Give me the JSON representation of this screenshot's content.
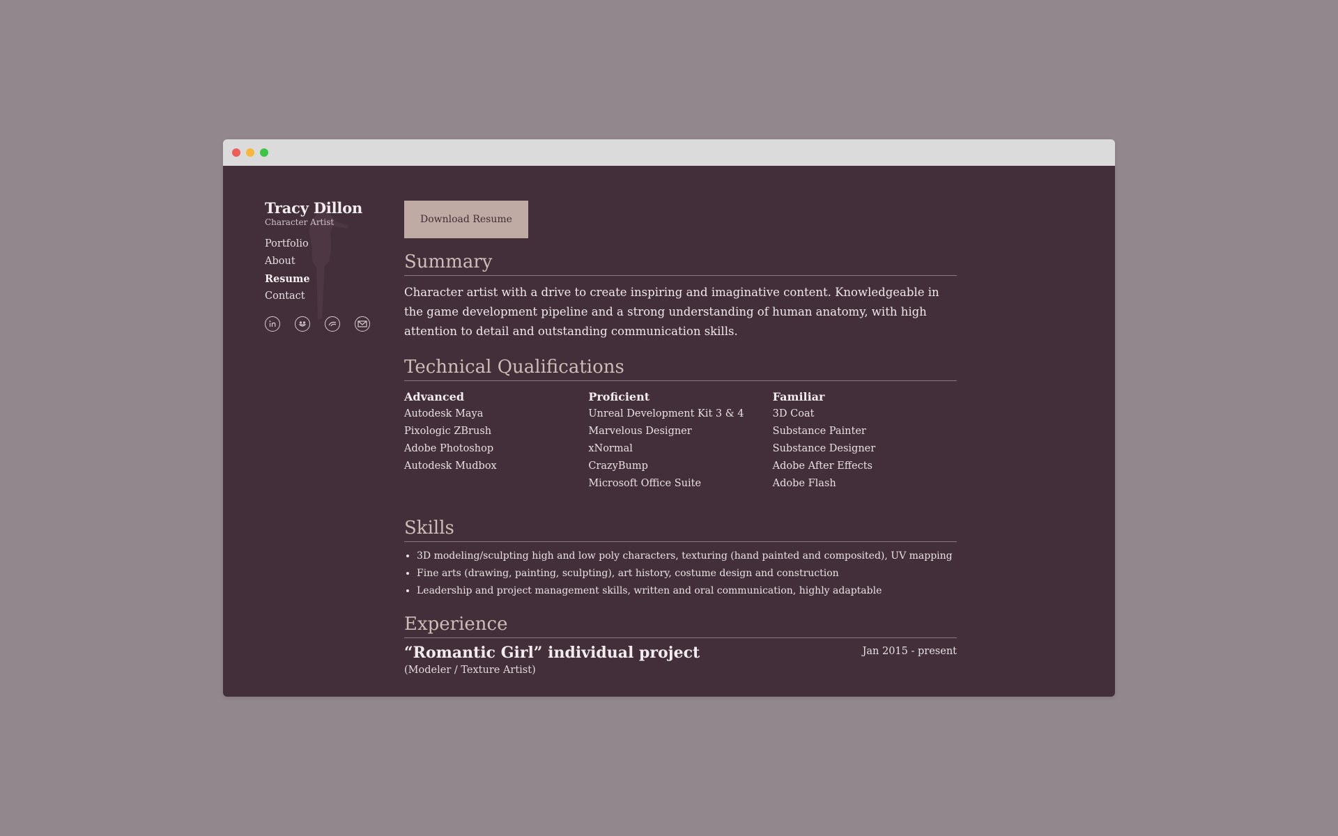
{
  "window": {
    "controls": [
      "close",
      "minimize",
      "maximize"
    ]
  },
  "sidebar": {
    "name": "Tracy Dillon",
    "subtitle": "Character Artist",
    "nav": [
      {
        "label": "Portfolio",
        "active": false
      },
      {
        "label": "About",
        "active": false
      },
      {
        "label": "Resume",
        "active": true
      },
      {
        "label": "Contact",
        "active": false
      }
    ],
    "social_icons": [
      "linkedin-icon",
      "smiley-icon",
      "artstation-icon",
      "mail-icon"
    ]
  },
  "main": {
    "download_button": "Download Resume",
    "summary": {
      "title": "Summary",
      "text": "Character artist with a drive to create inspiring and imaginative content. Knowledgeable in the game development pipeline and a strong understanding of human anatomy, with high attention to detail and outstanding communication skills."
    },
    "qualifications": {
      "title": "Technical Qualifications",
      "columns": [
        {
          "heading": "Advanced",
          "items": [
            "Autodesk Maya",
            "Pixologic ZBrush",
            "Adobe Photoshop",
            "Autodesk Mudbox"
          ]
        },
        {
          "heading": "Proficient",
          "items": [
            "Unreal Development Kit 3 & 4",
            "Marvelous Designer",
            "xNormal",
            "CrazyBump",
            "Microsoft Office Suite"
          ]
        },
        {
          "heading": "Familiar",
          "items": [
            "3D Coat",
            "Substance Painter",
            "Substance Designer",
            "Adobe After Effects",
            "Adobe Flash"
          ]
        }
      ]
    },
    "skills": {
      "title": "Skills",
      "items": [
        "3D modeling/sculpting high and low poly characters, texturing (hand painted and composited), UV mapping",
        "Fine arts (drawing, painting, sculpting), art history, costume design and construction",
        "Leadership and project management skills, written and oral communication, highly adaptable"
      ]
    },
    "experience": {
      "title": "Experience",
      "entries": [
        {
          "title": "“Romantic Girl” individual project",
          "date": "Jan 2015 - present",
          "role": "(Modeler / Texture Artist)"
        }
      ]
    }
  },
  "colors": {
    "page_bg": "#93878e",
    "content_bg": "#432f39",
    "button_bg": "#c0aaa4",
    "heading": "#cdbcb7"
  }
}
